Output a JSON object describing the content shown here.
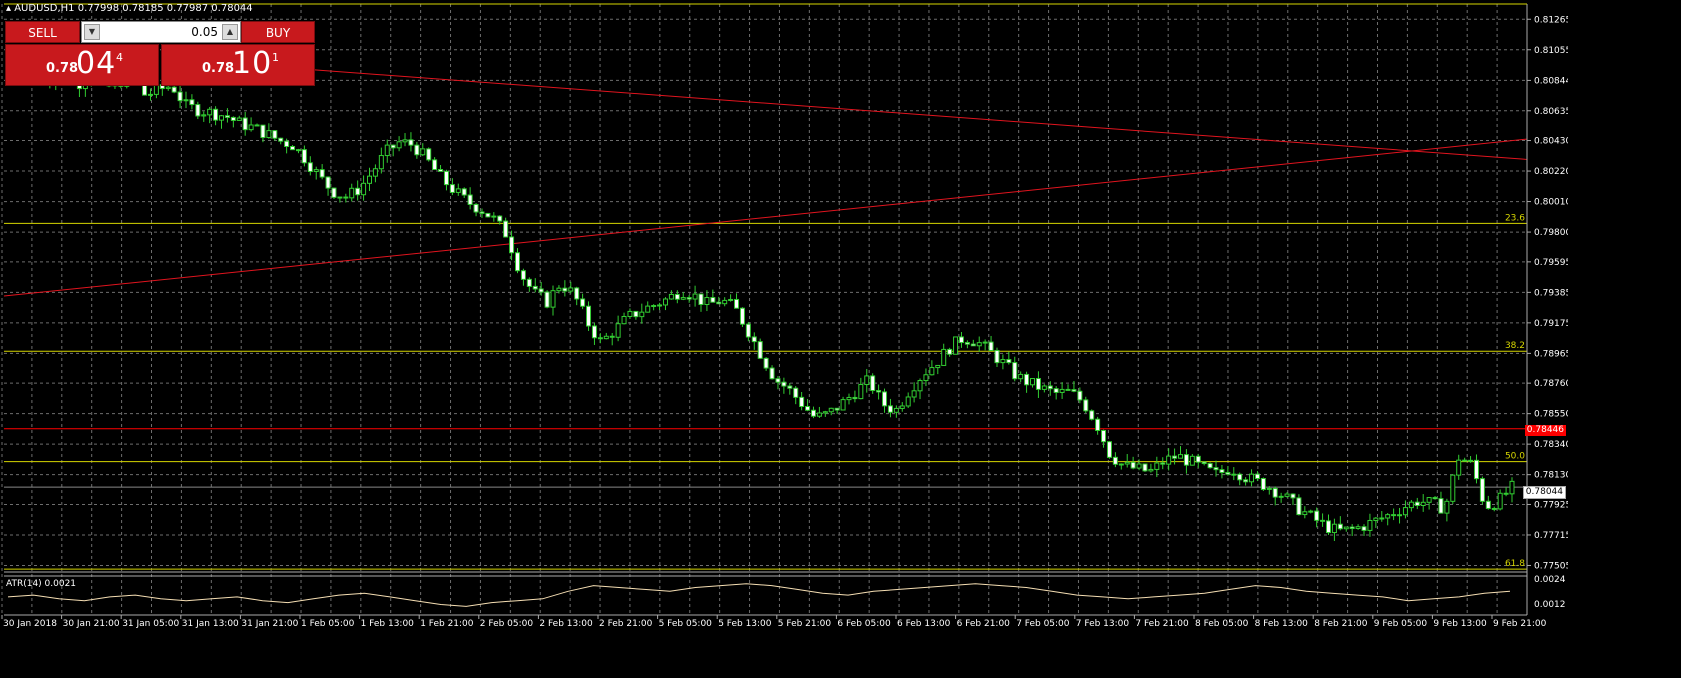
{
  "header": {
    "symbol": "AUDUSD,H1",
    "ohlc": "0.77998 0.78185 0.77987 0.78044"
  },
  "trade_panel": {
    "sell_label": "SELL",
    "buy_label": "BUY",
    "lot": "0.05",
    "sell_price_prefix": "0.78",
    "sell_price_big": "04",
    "sell_price_sup": "4",
    "buy_price_prefix": "0.78",
    "buy_price_big": "10",
    "buy_price_sup": "1"
  },
  "colors": {
    "background": "#000000",
    "grid": "#6e6e6e",
    "bull_candle": "#32cd32",
    "fibo": "#d6d600",
    "trendline": "#e0141e",
    "current_price_tag": "#ff0000",
    "indicator_line": "#f5deb3"
  },
  "price_axis": {
    "labels": [
      "0.81265",
      "0.81055",
      "0.80844",
      "0.80635",
      "0.80430",
      "0.80220",
      "0.80010",
      "0.79800",
      "0.79595",
      "0.79385",
      "0.79175",
      "0.78965",
      "0.78760",
      "0.78550",
      "0.78340",
      "0.78130",
      "0.77925",
      "0.77715",
      "0.77505"
    ],
    "current_price_tag": "0.78446",
    "last_price_tag": "0.78044"
  },
  "fibo_levels": [
    {
      "label": "23.6",
      "price": 0.7986
    },
    {
      "label": "38.2",
      "price": 0.7898
    },
    {
      "label": "50.0",
      "price": 0.7822
    },
    {
      "label": "61.8",
      "price": 0.7748
    }
  ],
  "time_axis": {
    "labels": [
      "30 Jan 2018",
      "30 Jan 21:00",
      "31 Jan 05:00",
      "31 Jan 13:00",
      "31 Jan 21:00",
      "1 Feb 05:00",
      "1 Feb 13:00",
      "1 Feb 21:00",
      "2 Feb 05:00",
      "2 Feb 13:00",
      "2 Feb 21:00",
      "5 Feb 05:00",
      "5 Feb 13:00",
      "5 Feb 21:00",
      "6 Feb 05:00",
      "6 Feb 13:00",
      "6 Feb 21:00",
      "7 Feb 05:00",
      "7 Feb 13:00",
      "7 Feb 21:00",
      "8 Feb 05:00",
      "8 Feb 13:00",
      "8 Feb 21:00",
      "9 Feb 05:00",
      "9 Feb 13:00",
      "9 Feb 21:00"
    ]
  },
  "indicator": {
    "label": "ATR(14) 0.0021",
    "axis_labels": [
      "0.0024",
      "0.0012"
    ]
  },
  "chart_data": {
    "type": "candlestick",
    "symbol": "AUDUSD",
    "timeframe": "H1",
    "ylim": [
      0.7746,
      0.8137
    ],
    "close_path": [
      0.8088,
      0.8086,
      0.809,
      0.8082,
      0.8091,
      0.8079,
      0.8083,
      0.8089,
      0.8074,
      0.8078,
      0.8081,
      0.8067,
      0.8064,
      0.8062,
      0.806,
      0.8055,
      0.8052,
      0.8048,
      0.8043,
      0.804,
      0.803,
      0.8018,
      0.8008,
      0.8004,
      0.801,
      0.8022,
      0.8035,
      0.8042,
      0.804,
      0.803,
      0.8018,
      0.8009,
      0.8001,
      0.7996,
      0.7989,
      0.7978,
      0.7952,
      0.7938,
      0.7932,
      0.7945,
      0.7937,
      0.7918,
      0.7904,
      0.7912,
      0.7921,
      0.7926,
      0.793,
      0.7934,
      0.794,
      0.7936,
      0.793,
      0.7933,
      0.7928,
      0.7912,
      0.7895,
      0.7879,
      0.7872,
      0.7862,
      0.7852,
      0.7855,
      0.7862,
      0.787,
      0.7878,
      0.7862,
      0.7857,
      0.7871,
      0.7882,
      0.789,
      0.79,
      0.7907,
      0.7905,
      0.7898,
      0.789,
      0.7881,
      0.7876,
      0.7872,
      0.7869,
      0.787,
      0.7863,
      0.7848,
      0.7827,
      0.7819,
      0.7817,
      0.7815,
      0.7822,
      0.7826,
      0.7822,
      0.7817,
      0.7813,
      0.7818,
      0.7812,
      0.7808,
      0.7804,
      0.7798,
      0.779,
      0.7784,
      0.7778,
      0.7774,
      0.7775,
      0.7778,
      0.7782,
      0.7786,
      0.7791,
      0.7795,
      0.7793,
      0.779,
      0.7825,
      0.782,
      0.7791,
      0.7795,
      0.7804
    ],
    "horizontal_lines": [
      {
        "type": "fibo",
        "label": "23.6",
        "price": 0.7986
      },
      {
        "type": "fibo",
        "label": "38.2",
        "price": 0.7898
      },
      {
        "type": "fibo",
        "label": "50.0",
        "price": 0.7822
      },
      {
        "type": "fibo",
        "label": "61.8",
        "price": 0.7748
      },
      {
        "type": "price",
        "label": "0.78446",
        "price": 0.78446
      },
      {
        "type": "price",
        "label": "0.78044",
        "price": 0.78044
      }
    ],
    "trendlines": [
      {
        "from_price": 0.8098,
        "to_price": 0.803
      },
      {
        "from_price": 0.7936,
        "to_price": 0.8044
      }
    ],
    "atr_series": [
      0.0018,
      0.0019,
      0.0017,
      0.0016,
      0.0018,
      0.0019,
      0.0017,
      0.0016,
      0.0017,
      0.0018,
      0.0016,
      0.0015,
      0.0017,
      0.0019,
      0.002,
      0.0018,
      0.0016,
      0.0014,
      0.0013,
      0.0015,
      0.0016,
      0.0017,
      0.0021,
      0.0024,
      0.0023,
      0.0022,
      0.0021,
      0.0023,
      0.0024,
      0.0025,
      0.0024,
      0.0022,
      0.002,
      0.0019,
      0.0021,
      0.0022,
      0.0023,
      0.0024,
      0.0025,
      0.0024,
      0.0023,
      0.0021,
      0.0019,
      0.0018,
      0.0017,
      0.0018,
      0.0019,
      0.002,
      0.0022,
      0.0024,
      0.0023,
      0.0021,
      0.002,
      0.0019,
      0.0018,
      0.0016,
      0.0017,
      0.0018,
      0.002,
      0.0021
    ]
  }
}
